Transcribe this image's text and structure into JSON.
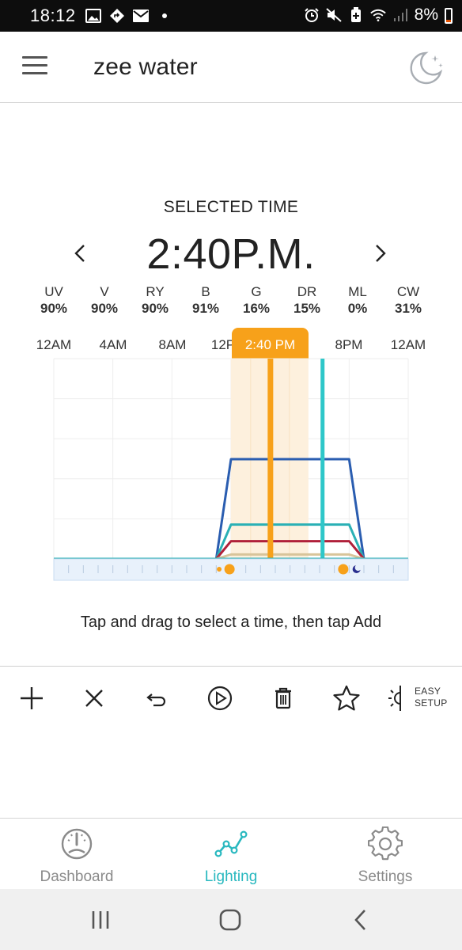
{
  "status_bar": {
    "time": "18:12",
    "battery_text": "8%",
    "left_icons": [
      "image-icon",
      "location-diamond-icon",
      "mail-icon",
      "dot-icon"
    ],
    "right_icons": [
      "alarm-icon",
      "mute-icon",
      "battery-saver-icon",
      "wifi-icon",
      "signal-icon"
    ]
  },
  "app_bar": {
    "title": "zee water",
    "menu_icon": "hamburger-menu-icon",
    "mode_icon": "moon-stars-icon"
  },
  "selected_time": {
    "label": "SELECTED TIME",
    "value": "2:40P.M.",
    "prev_icon": "chevron-left-icon",
    "next_icon": "chevron-right-icon"
  },
  "channels": [
    {
      "name": "UV",
      "value": "90%"
    },
    {
      "name": "V",
      "value": "90%"
    },
    {
      "name": "RY",
      "value": "90%"
    },
    {
      "name": "B",
      "value": "91%"
    },
    {
      "name": "G",
      "value": "16%"
    },
    {
      "name": "DR",
      "value": "15%"
    },
    {
      "name": "ML",
      "value": "0%"
    },
    {
      "name": "CW",
      "value": "31%"
    }
  ],
  "axis_labels": [
    "12AM",
    "4AM",
    "8AM",
    "12P",
    "8PM",
    "12AM"
  ],
  "marker": {
    "label": "2:40 PM",
    "color": "#f7a11a"
  },
  "hint": "Tap and drag to select a time, then tap Add",
  "chart_data": {
    "type": "line",
    "x_unit": "hour",
    "xlim": [
      0,
      24
    ],
    "ylim": [
      0,
      100
    ],
    "x_ticks": [
      "12AM",
      "4AM",
      "8AM",
      "12P",
      "8PM",
      "12AM"
    ],
    "selected_x": 14.67,
    "current_time_x": 18.2,
    "series": [
      {
        "color": "#2a5db0",
        "points": [
          [
            0,
            0
          ],
          [
            11,
            0
          ],
          [
            12,
            90
          ],
          [
            20,
            90
          ],
          [
            21,
            0
          ],
          [
            24,
            0
          ]
        ]
      },
      {
        "color": "#2ab0b5",
        "points": [
          [
            0,
            0
          ],
          [
            11,
            0
          ],
          [
            12,
            31
          ],
          [
            20,
            31
          ],
          [
            21,
            0
          ],
          [
            24,
            0
          ]
        ]
      },
      {
        "color": "#b0203a",
        "points": [
          [
            0,
            0
          ],
          [
            11,
            0
          ],
          [
            12,
            16
          ],
          [
            20,
            16
          ],
          [
            21,
            0
          ],
          [
            24,
            0
          ]
        ]
      },
      {
        "color": "#d8c49a",
        "points": [
          [
            0,
            0
          ],
          [
            11,
            0
          ],
          [
            12,
            4
          ],
          [
            20,
            4
          ],
          [
            21,
            0
          ],
          [
            24,
            0
          ]
        ]
      }
    ],
    "colors": {
      "selection": "#f7a11a",
      "now_line": "#2ec7c9",
      "highlight": "#fdf0dd"
    }
  },
  "toolbar": {
    "add_icon": "plus-icon",
    "clear_icon": "close-icon",
    "undo_icon": "undo-icon",
    "play_icon": "play-circle-icon",
    "delete_icon": "trash-icon",
    "favorite_icon": "star-icon",
    "easy_setup_icon": "sun-half-icon",
    "easy_setup_line1": "EASY",
    "easy_setup_line2": "SETUP"
  },
  "bottom_nav": {
    "items": [
      {
        "label": "Dashboard",
        "icon": "gauge-icon"
      },
      {
        "label": "Lighting",
        "icon": "line-chart-icon"
      },
      {
        "label": "Settings",
        "icon": "gear-icon"
      }
    ],
    "active_color": "#28b8bf"
  }
}
